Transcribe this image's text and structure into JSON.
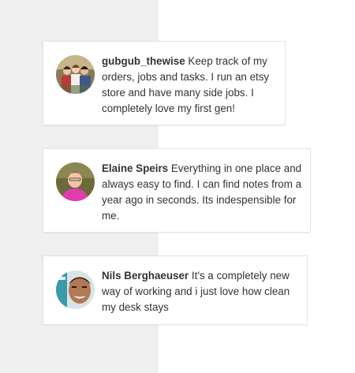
{
  "testimonials": [
    {
      "username": "gubgub_thewise",
      "text": "Keep track of my orders, jobs and tasks. I run an etsy store and have many side jobs. I completely love my first gen!",
      "avatar_icon": "avatar-group-photo"
    },
    {
      "username": "Elaine Speirs",
      "text": "Everything in one place and always easy to find. I can find notes from a year ago in seconds. Its indespensible for me.",
      "avatar_icon": "avatar-woman-pink-shirt"
    },
    {
      "username": "Nils Berghaeuser",
      "text": "It's a completely new way of working and i just love how clean my desk stays",
      "avatar_icon": "avatar-man-smiling"
    }
  ],
  "colors": {
    "left_panel": "#efefef",
    "card_border": "#e3e3e3",
    "text": "#333333"
  }
}
